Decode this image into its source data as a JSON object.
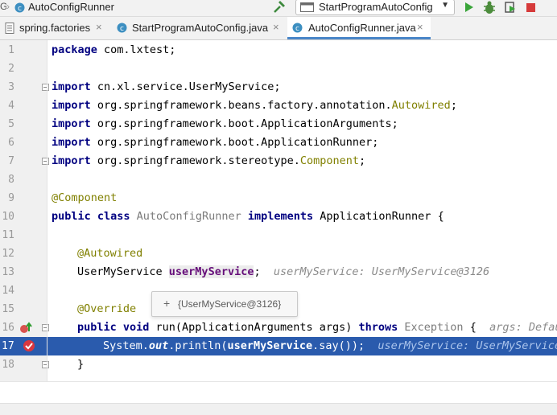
{
  "toolbar": {
    "breadcrumb_prefix": "G",
    "breadcrumb_class": "AutoConfigRunner",
    "run_config": "StartProgramAutoConfig",
    "icons": [
      "build-hammer-icon",
      "run-icon",
      "debug-icon",
      "coverage-icon",
      "stop-icon"
    ]
  },
  "tabs": [
    {
      "label": "spring.factories",
      "icon": "properties-file-icon",
      "active": false
    },
    {
      "label": "StartProgramAutoConfig.java",
      "icon": "java-class-icon",
      "active": false
    },
    {
      "label": "AutoConfigRunner.java",
      "icon": "java-class-icon",
      "active": true
    }
  ],
  "gutter": {
    "line_numbers": [
      "1",
      "2",
      "3",
      "4",
      "5",
      "6",
      "7",
      "8",
      "9",
      "10",
      "11",
      "12",
      "13",
      "14",
      "15",
      "16",
      "17",
      "18"
    ]
  },
  "code": {
    "l1": {
      "kw": "package",
      "rest": " com.lxtest;"
    },
    "l3": {
      "kw": "import",
      "rest": " cn.xl.service.UserMyService;"
    },
    "l4": {
      "kw": "import",
      "rest": " org.springframework.beans.factory.annotation.",
      "ann": "Autowired",
      "end": ";"
    },
    "l5": {
      "kw": "import",
      "rest": " org.springframework.boot.ApplicationArguments;"
    },
    "l6": {
      "kw": "import",
      "rest": " org.springframework.boot.ApplicationRunner;"
    },
    "l7": {
      "kw": "import",
      "rest": " org.springframework.stereotype.",
      "ann": "Component",
      "end": ";"
    },
    "l9": {
      "ann": "@Component"
    },
    "l10": {
      "kw1": "public class",
      "cls": " AutoConfigRunner ",
      "kw2": "implements",
      "rest": " ApplicationRunner {"
    },
    "l12": {
      "ann": "@Autowired"
    },
    "l13": {
      "type": "UserMyService ",
      "field": "userMyService",
      "end": ";",
      "hint": "userMyService: UserMyService@3126"
    },
    "l15": {
      "ann": "@Override"
    },
    "l16": {
      "kw1": "public void",
      "pre": " run(ApplicationArguments args) ",
      "kw2": "throws",
      "exc": " Exception",
      "end": " {",
      "hint": "args: Default"
    },
    "l17": {
      "pre": "System.",
      "static": "out",
      "mid": ".println(",
      "field": "userMyService",
      "end": ".say());",
      "hint": "userMyService: UserMyService@"
    },
    "l18": {
      "text": "}"
    }
  },
  "tooltip": {
    "text": "{UserMyService@3126}"
  },
  "colors": {
    "keyword": "#000080",
    "annotation": "#808000",
    "field": "#660e7a",
    "selection": "#2a5bad",
    "gutter": "#f0f0f0"
  }
}
